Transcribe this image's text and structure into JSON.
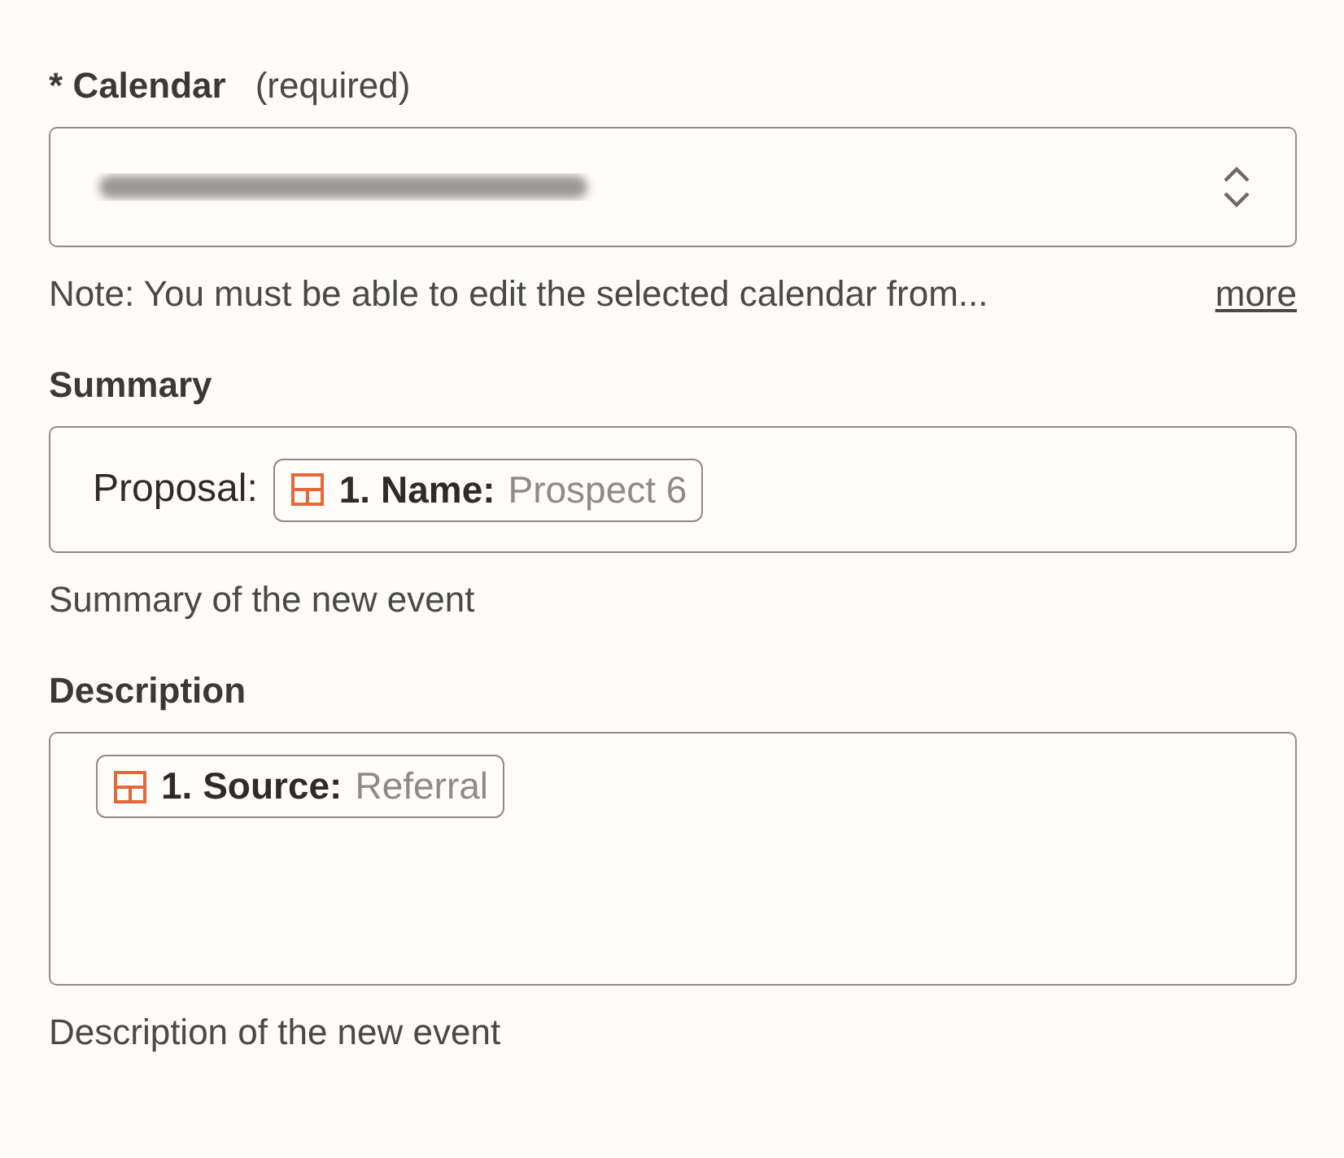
{
  "fields": [
    {
      "kind": "select",
      "label": "Calendar",
      "required_mark": "*",
      "required_note": "(required)",
      "value_redacted": true,
      "help": "Note: You must be able to edit the selected calendar from...",
      "help_link": "more"
    },
    {
      "kind": "text",
      "label": "Summary",
      "content": [
        {
          "kind": "text",
          "text": "Proposal:"
        },
        {
          "kind": "token",
          "key": "1. Name:",
          "value": "Prospect 6"
        }
      ],
      "help": "Summary of the new event"
    },
    {
      "kind": "textarea",
      "label": "Description",
      "content": [
        {
          "kind": "token",
          "key": "1. Source:",
          "value": "Referral"
        }
      ],
      "help": "Description of the new event"
    }
  ]
}
